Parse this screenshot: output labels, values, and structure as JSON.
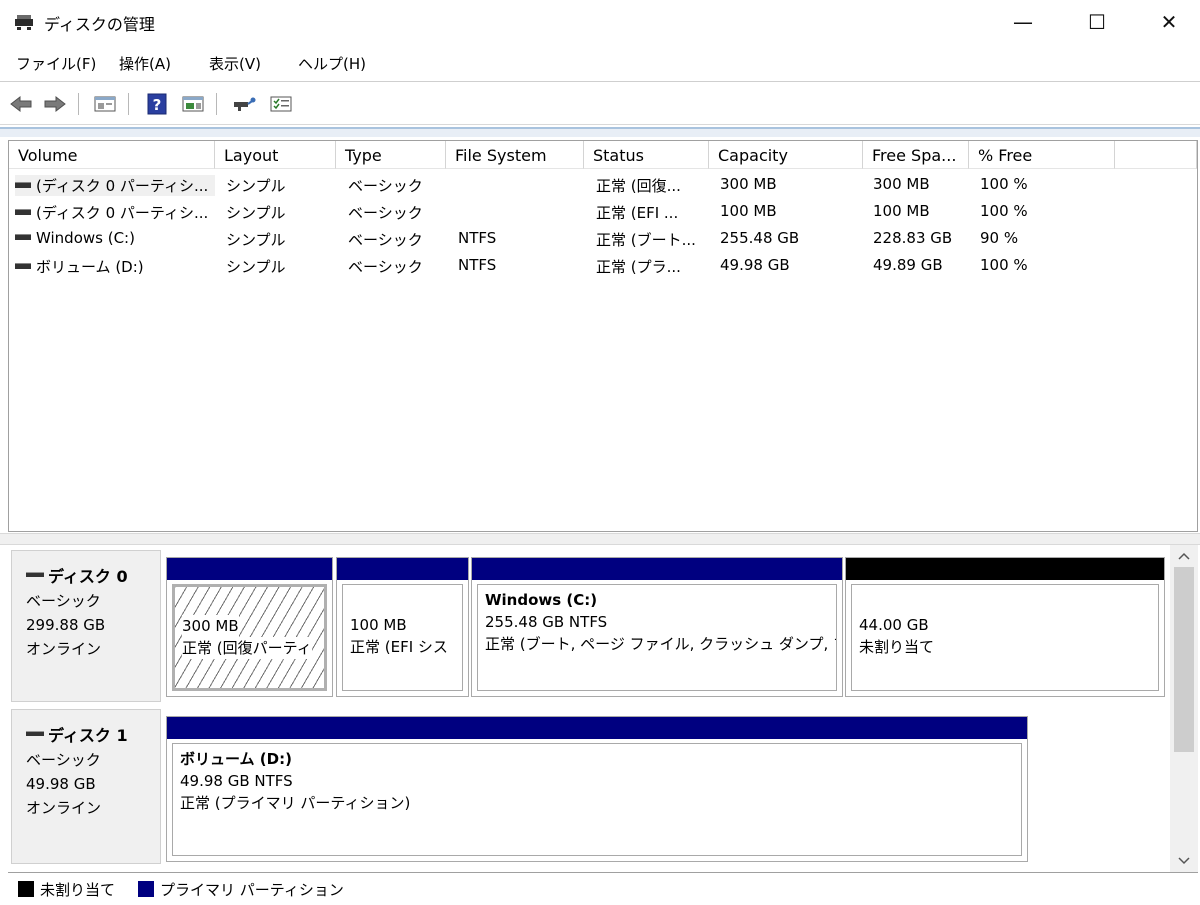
{
  "window": {
    "title": "ディスクの管理",
    "minimize": "—",
    "maximize": "☐",
    "close": "✕"
  },
  "menu": [
    "ファイル(F)",
    "操作(A)",
    "表示(V)",
    "ヘルプ(H)"
  ],
  "toolbar_icons": [
    "back-arrow-icon",
    "forward-arrow-icon",
    "console-tree-icon",
    "help-icon",
    "action-pane-icon",
    "connect-disk-icon",
    "properties-icon"
  ],
  "columns": [
    "Volume",
    "Layout",
    "Type",
    "File System",
    "Status",
    "Capacity",
    "Free Spa...",
    "% Free"
  ],
  "volumes": [
    {
      "volume": "(ディスク 0 パーティシ...",
      "layout": "シンプル",
      "type": "ベーシック",
      "fs": "",
      "status": "正常 (回復...",
      "capacity": "300 MB",
      "free": "300 MB",
      "pct": "100 %"
    },
    {
      "volume": "(ディスク 0 パーティシ...",
      "layout": "シンプル",
      "type": "ベーシック",
      "fs": "",
      "status": "正常 (EFI ...",
      "capacity": "100 MB",
      "free": "100 MB",
      "pct": "100 %"
    },
    {
      "volume": "Windows (C:)",
      "layout": "シンプル",
      "type": "ベーシック",
      "fs": "NTFS",
      "status": "正常 (ブート...",
      "capacity": "255.48 GB",
      "free": "228.83 GB",
      "pct": "90 %"
    },
    {
      "volume": "ボリューム (D:)",
      "layout": "シンプル",
      "type": "ベーシック",
      "fs": "NTFS",
      "status": "正常 (プラ...",
      "capacity": "49.98 GB",
      "free": "49.89 GB",
      "pct": "100 %"
    }
  ],
  "disks": [
    {
      "name": "ディスク 0",
      "type": "ベーシック",
      "size": "299.88 GB",
      "state": "オンライン",
      "partitions": [
        {
          "title": "",
          "size": "300 MB",
          "status": "正常 (回復パーティ"
        },
        {
          "title": "",
          "size": "100 MB",
          "status": "正常 (EFI シス"
        },
        {
          "title": "Windows  (C:)",
          "size": "255.48 GB NTFS",
          "status": "正常 (ブート, ページ ファイル, クラッシュ ダンプ, プ"
        },
        {
          "title": "",
          "size": "44.00 GB",
          "status": "未割り当て"
        }
      ]
    },
    {
      "name": "ディスク 1",
      "type": "ベーシック",
      "size": "49.98 GB",
      "state": "オンライン",
      "partitions": [
        {
          "title": "ボリューム  (D:)",
          "size": "49.98 GB NTFS",
          "status": "正常 (プライマリ パーティション)"
        }
      ]
    }
  ],
  "legend": [
    {
      "label": "未割り当て",
      "color": "#000000"
    },
    {
      "label": "プライマリ パーティション",
      "color": "#000080"
    }
  ],
  "colors": {
    "primary_partition": "#000080",
    "unallocated": "#000000"
  }
}
